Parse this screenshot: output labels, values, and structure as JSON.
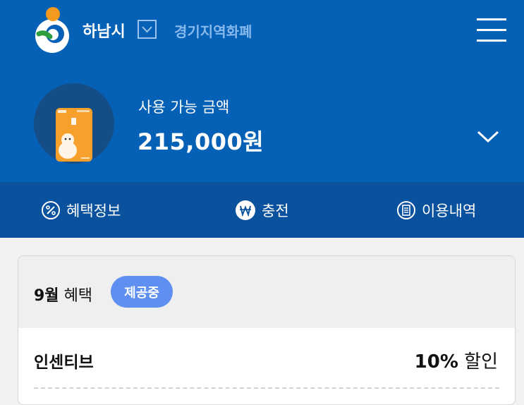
{
  "header": {
    "city_name": "하남시",
    "region_currency": "경기지역화폐"
  },
  "balance": {
    "label": "사용 가능 금액",
    "amount": "215,000원"
  },
  "tabs": [
    {
      "label": "혜택정보",
      "icon": "percent-icon"
    },
    {
      "label": "충전",
      "icon": "won-icon"
    },
    {
      "label": "이용내역",
      "icon": "receipt-icon"
    }
  ],
  "benefits": {
    "month": "9월",
    "title": "혜택",
    "status_badge": "제공중",
    "incentive_label": "인센티브",
    "incentive_rate": "10%",
    "incentive_suffix": "할인"
  },
  "colors": {
    "header_bg": "#0561b5",
    "tabs_bg": "#0a519e",
    "badge_bg": "#5e8ff1",
    "card": "#f7a12c"
  }
}
